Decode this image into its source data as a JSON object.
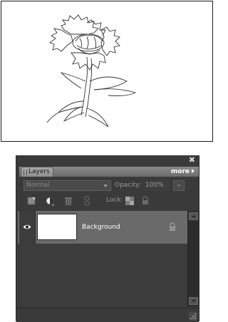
{
  "panel": {
    "close_glyph": "✖",
    "tab_label": "Layers",
    "more_label": "more",
    "blend_mode": "Normal",
    "opacity_label": "Opacity:",
    "opacity_value": "100%",
    "lock_label": "Lock:"
  },
  "layers": [
    {
      "name": "Background",
      "visible": true,
      "locked": true
    }
  ],
  "icons": {
    "new_layer": "new-layer-icon",
    "adjustment": "adjustment-layer-icon",
    "delete": "trash-icon",
    "link": "link-icon",
    "lock_transparent": "lock-transparency-icon",
    "lock_all": "lock-all-icon",
    "visibility": "eye-icon",
    "layer_lock": "padlock-icon"
  },
  "colors": {
    "panel_bg": "#3a3a3a",
    "selected_row": "#6a6a6a",
    "text_dim": "#9a9a9a"
  }
}
